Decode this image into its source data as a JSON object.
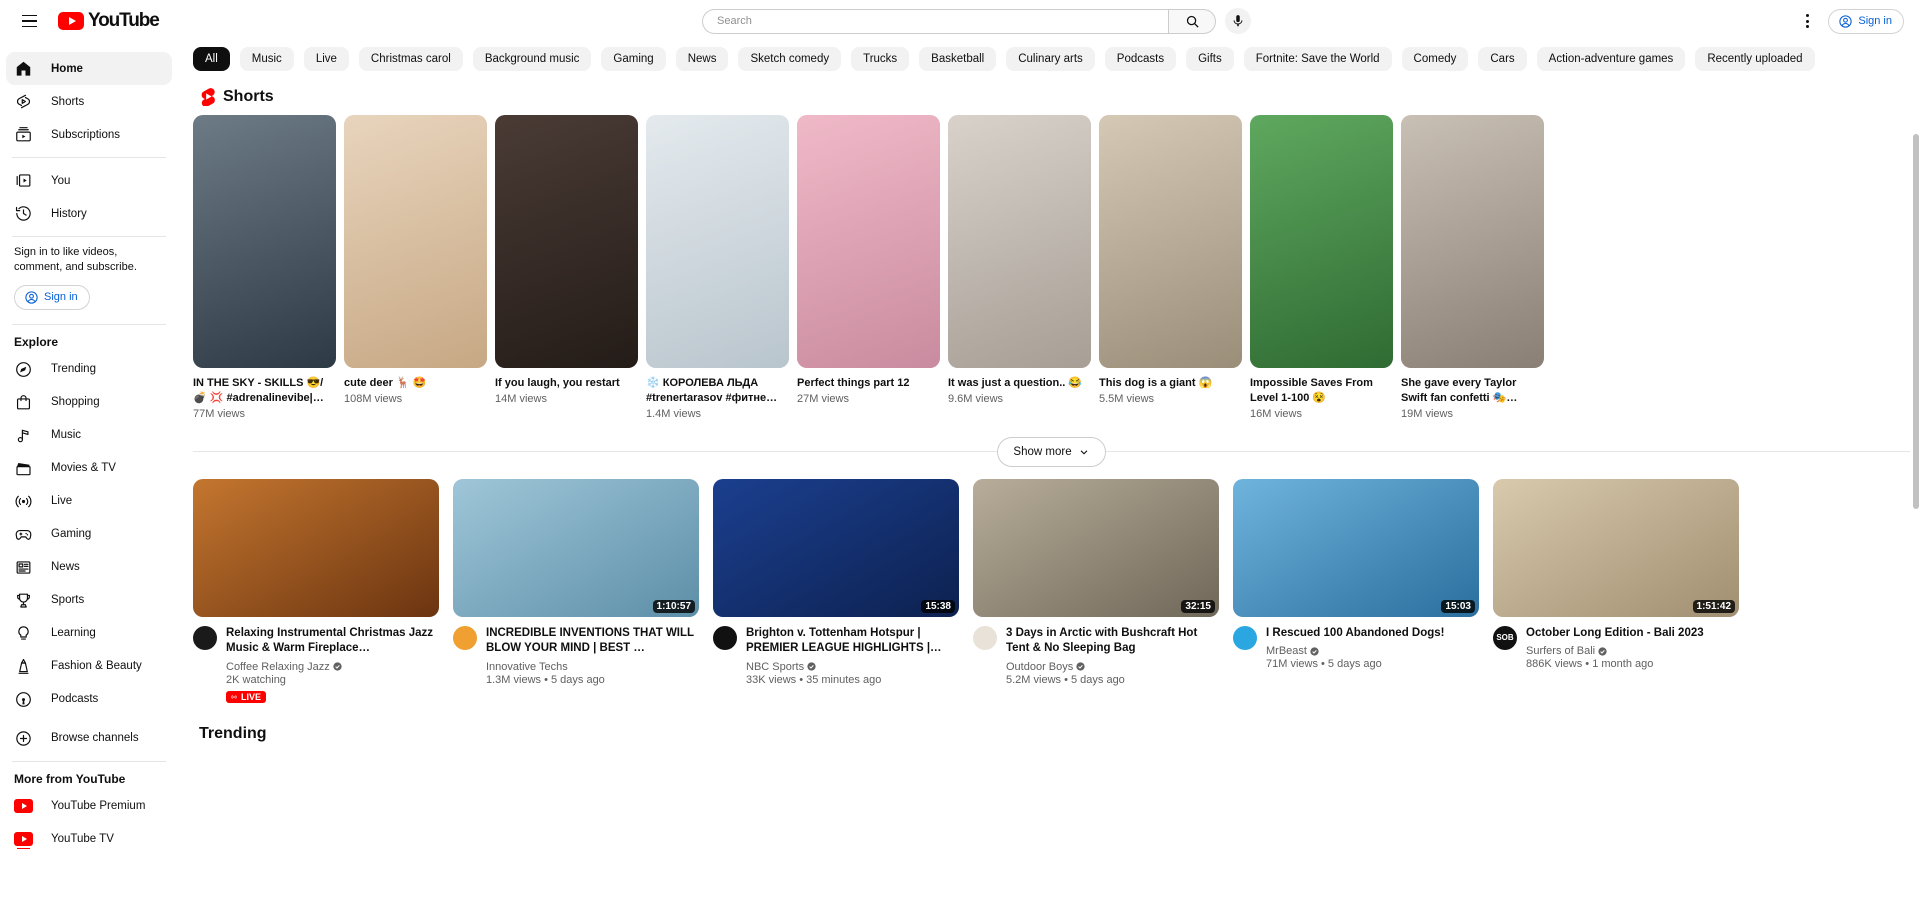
{
  "masthead": {
    "menu_label": "Guide",
    "logo_text": "YouTube",
    "search": {
      "value": "",
      "placeholder": "Search"
    },
    "search_button_label": "Search",
    "mic_label": "Search with your voice",
    "settings_label": "Settings",
    "sign_in_label": "Sign in"
  },
  "sidebar": {
    "primary": [
      {
        "label": "Home",
        "icon": "home-icon",
        "active": true
      },
      {
        "label": "Shorts",
        "icon": "shorts-icon",
        "active": false
      },
      {
        "label": "Subscriptions",
        "icon": "subscriptions-icon",
        "active": false
      }
    ],
    "secondary": [
      {
        "label": "You",
        "icon": "you-icon"
      },
      {
        "label": "History",
        "icon": "history-icon"
      }
    ],
    "signin_blurb": "Sign in to like videos, comment, and subscribe.",
    "signin_label": "Sign in",
    "explore_title": "Explore",
    "explore": [
      {
        "label": "Trending",
        "icon": "trending-icon"
      },
      {
        "label": "Shopping",
        "icon": "shopping-icon"
      },
      {
        "label": "Music",
        "icon": "music-icon"
      },
      {
        "label": "Movies & TV",
        "icon": "movies-tv-icon"
      },
      {
        "label": "Live",
        "icon": "live-icon"
      },
      {
        "label": "Gaming",
        "icon": "gaming-icon"
      },
      {
        "label": "News",
        "icon": "news-icon"
      },
      {
        "label": "Sports",
        "icon": "sports-icon"
      },
      {
        "label": "Learning",
        "icon": "learning-icon"
      },
      {
        "label": "Fashion & Beauty",
        "icon": "fashion-beauty-icon"
      },
      {
        "label": "Podcasts",
        "icon": "podcasts-icon"
      }
    ],
    "browse_channels": {
      "label": "Browse channels",
      "icon": "plus-circle-icon"
    },
    "more_title": "More from YouTube",
    "more": [
      {
        "label": "YouTube Premium",
        "icon": "youtube-premium-icon"
      },
      {
        "label": "YouTube TV",
        "icon": "youtube-tv-icon"
      }
    ]
  },
  "chips": [
    {
      "label": "All",
      "selected": true
    },
    {
      "label": "Music",
      "selected": false
    },
    {
      "label": "Live",
      "selected": false
    },
    {
      "label": "Christmas carol",
      "selected": false
    },
    {
      "label": "Background music",
      "selected": false
    },
    {
      "label": "Gaming",
      "selected": false
    },
    {
      "label": "News",
      "selected": false
    },
    {
      "label": "Sketch comedy",
      "selected": false
    },
    {
      "label": "Trucks",
      "selected": false
    },
    {
      "label": "Basketball",
      "selected": false
    },
    {
      "label": "Culinary arts",
      "selected": false
    },
    {
      "label": "Podcasts",
      "selected": false
    },
    {
      "label": "Gifts",
      "selected": false
    },
    {
      "label": "Fortnite: Save the World",
      "selected": false
    },
    {
      "label": "Comedy",
      "selected": false
    },
    {
      "label": "Cars",
      "selected": false
    },
    {
      "label": "Action-adventure games",
      "selected": false
    },
    {
      "label": "Recently uploaded",
      "selected": false
    }
  ],
  "shorts_shelf": {
    "title": "Shorts",
    "items": [
      {
        "title": "IN THE SKY - SKILLS 😎/ 💣 💢 #adrenalinevibe|…",
        "views": "77M views",
        "c1": "#6d7b86",
        "c2": "#2d3a45"
      },
      {
        "title": "cute deer 🦌 🤩",
        "views": "108M views",
        "c1": "#e8d4bd",
        "c2": "#c7a884"
      },
      {
        "title": "If you laugh, you restart",
        "views": "14M views",
        "c1": "#4a3b35",
        "c2": "#241c18"
      },
      {
        "title": "❄️ КОРОЛЕВА ЛЬДА #trenertarasov #фитне…",
        "views": "1.4M views",
        "c1": "#e4eaee",
        "c2": "#b9c5cd"
      },
      {
        "title": "Perfect things part 12",
        "views": "27M views",
        "c1": "#f0b9c8",
        "c2": "#c98b9f"
      },
      {
        "title": "It was just a question.. 😂",
        "views": "9.6M views",
        "c1": "#d8d2cb",
        "c2": "#a79e95"
      },
      {
        "title": "This dog is a giant 😱",
        "views": "5.5M views",
        "c1": "#d5c9b6",
        "c2": "#9b8e79"
      },
      {
        "title": "Impossible Saves From Level 1-100 😵",
        "views": "16M views",
        "c1": "#5fa85f",
        "c2": "#2f6b33"
      },
      {
        "title": "She gave every Taylor Swift fan confetti 🎭…",
        "views": "19M views",
        "c1": "#c9c0b5",
        "c2": "#8a7f74"
      }
    ],
    "show_more_label": "Show more"
  },
  "video_grid": [
    {
      "title": "Relaxing Instrumental Christmas Jazz Music & Warm Fireplace…",
      "channel": "Coffee Relaxing Jazz",
      "verified": true,
      "stats": "2K watching",
      "duration": "",
      "live": true,
      "live_label": "LIVE",
      "avatar_text": "",
      "avatar_color": "#1a1a1a",
      "c1": "#c4762f",
      "c2": "#6b3410"
    },
    {
      "title": "INCREDIBLE INVENTIONS THAT WILL BLOW YOUR MIND | BEST …",
      "channel": "Innovative Techs",
      "verified": false,
      "stats": "1.3M views • 5 days ago",
      "duration": "1:10:57",
      "live": false,
      "avatar_text": "",
      "avatar_color": "#f0a030",
      "c1": "#9fc6d8",
      "c2": "#5d8fa8"
    },
    {
      "title": "Brighton v. Tottenham Hotspur | PREMIER LEAGUE HIGHLIGHTS |…",
      "channel": "NBC Sports",
      "verified": true,
      "stats": "33K views • 35 minutes ago",
      "duration": "15:38",
      "live": false,
      "avatar_text": "",
      "avatar_color": "#111111",
      "c1": "#1b3f8f",
      "c2": "#0d2150"
    },
    {
      "title": "3 Days in Arctic with Bushcraft Hot Tent & No Sleeping Bag",
      "channel": "Outdoor Boys",
      "verified": true,
      "stats": "5.2M views • 5 days ago",
      "duration": "32:15",
      "live": false,
      "avatar_text": "",
      "avatar_color": "#e8e2d8",
      "c1": "#b8ad9a",
      "c2": "#6f6758"
    },
    {
      "title": "I Rescued 100 Abandoned Dogs!",
      "channel": "MrBeast",
      "verified": true,
      "stats": "71M views • 5 days ago",
      "duration": "15:03",
      "live": false,
      "avatar_text": "",
      "avatar_color": "#2aa7e0",
      "c1": "#6fb4dd",
      "c2": "#2a6f9e"
    },
    {
      "title": "October Long Edition - Bali 2023",
      "channel": "Surfers of Bali",
      "verified": true,
      "stats": "886K views • 1 month ago",
      "duration": "1:51:42",
      "live": false,
      "avatar_text": "SOB",
      "avatar_color": "#111111",
      "c1": "#d9c9ad",
      "c2": "#a08f70"
    }
  ],
  "trending": {
    "title": "Trending"
  }
}
